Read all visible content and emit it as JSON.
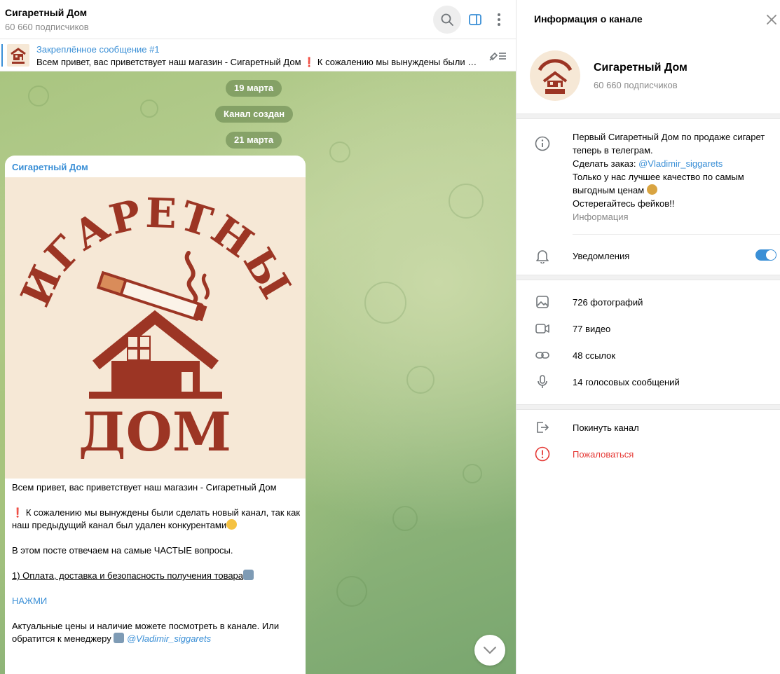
{
  "chat": {
    "title": "Сигаретный Дом",
    "subtitle": "60 660 подписчиков",
    "pinned": {
      "title": "Закреплённое сообщение #1",
      "text": "Всем привет, вас приветствует наш магазин  - Сигаретный Дом  ❗ К сожалению мы вынуждены были сделать новый канал, так как наш предыдущий канал был удален конкурентами"
    },
    "service_messages": [
      "19 марта",
      "Канал создан",
      "21 марта"
    ],
    "message": {
      "author": "Сигаретный Дом",
      "logo_text_top": "СИГАРЕТНЫЙ",
      "logo_text_bottom": "ДОМ",
      "line1": "Всем привет, вас приветствует наш магазин  - Сигаретный Дом",
      "line2": "К сожалению мы вынуждены были сделать новый канал, так как наш предыдущий канал был удален конкурентами",
      "line3": "В этом посте отвечаем на самые ЧАСТЫЕ вопросы.",
      "line4": " 1) Оплата, доставка и безопасность получения товара",
      "link": "НАЖМИ",
      "line5": "Актуальные цены и наличие можете посмотреть в канале. Или обратится к менеджеру",
      "mention": "@Vladimir_siggarets"
    }
  },
  "info": {
    "header": "Информация о канале",
    "name": "Сигаретный Дом",
    "subscribers": "60 660 подписчиков",
    "desc_line1": "Первый Сигаретный Дом по продаже сигарет теперь в телеграм.",
    "desc_order_prefix": "Сделать заказ: ",
    "desc_order_link": "@Vladimir_siggarets",
    "desc_line3": "Только у нас лучшее качество по самым выгодным ценам",
    "desc_line4": "Остерегайтесь фейков!!",
    "desc_caption": "Информация",
    "notifications": "Уведомления",
    "notifications_on": true,
    "media": {
      "photos": "726 фотографий",
      "videos": "77 видео",
      "links": "48 ссылок",
      "voice": "14 голосовых сообщений"
    },
    "leave": "Покинуть канал",
    "report": "Пожаловаться"
  },
  "colors": {
    "accent": "#3a8fd6",
    "danger": "#e53935",
    "logo_brown": "#9c3524",
    "logo_bg": "#f6e8d6"
  }
}
